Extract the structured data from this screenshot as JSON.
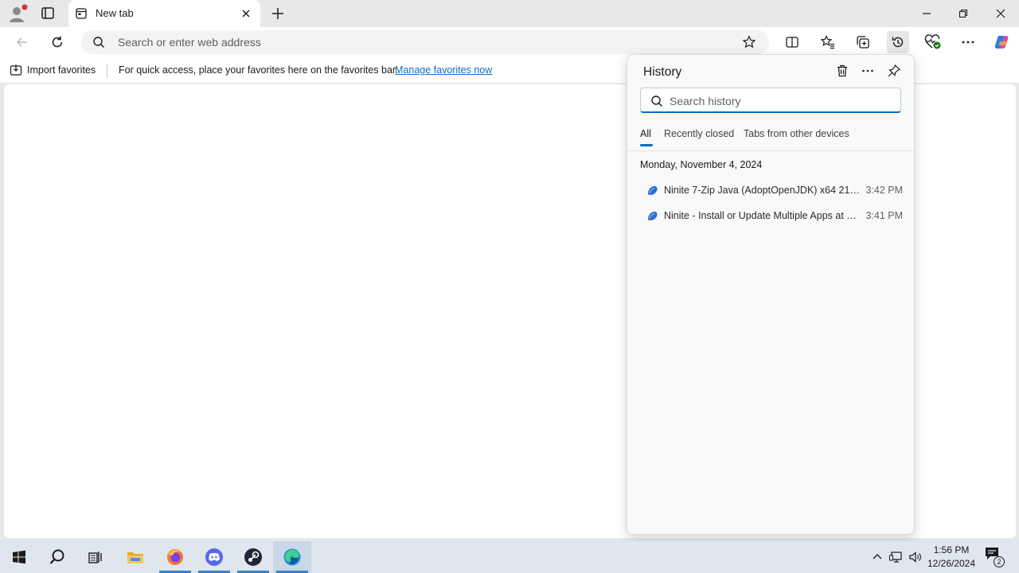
{
  "tab": {
    "title": "New tab"
  },
  "address": {
    "placeholder": "Search or enter web address"
  },
  "favorites_bar": {
    "import_label": "Import favorites",
    "message": "For quick access, place your favorites here on the favorites bar.",
    "manage_link": "Manage favorites now"
  },
  "history": {
    "title": "History",
    "search_placeholder": "Search history",
    "tabs": [
      {
        "label": "All",
        "active": true
      },
      {
        "label": "Recently closed",
        "active": false
      },
      {
        "label": "Tabs from other devices",
        "active": false
      }
    ],
    "date_heading": "Monday, November 4, 2024",
    "items": [
      {
        "title": "Ninite 7-Zip Java (AdoptOpenJDK) x64 21 Ev...",
        "time": "3:42 PM",
        "icon": "ninite-icon"
      },
      {
        "title": "Ninite - Install or Update Multiple Apps at O...",
        "time": "3:41 PM",
        "icon": "ninite-icon"
      }
    ]
  },
  "taskbar": {
    "apps": [
      "start-icon",
      "search-icon",
      "task-view-icon",
      "file-explorer-icon",
      "firefox-icon",
      "discord-icon",
      "steam-icon",
      "edge-icon"
    ],
    "time": "1:56 PM",
    "date": "12/26/2024",
    "notification_count": "2"
  },
  "colors": {
    "accent": "#0f6cbd",
    "tab_strip": "#e8e8e8",
    "taskbar": "#dfe6ee"
  }
}
